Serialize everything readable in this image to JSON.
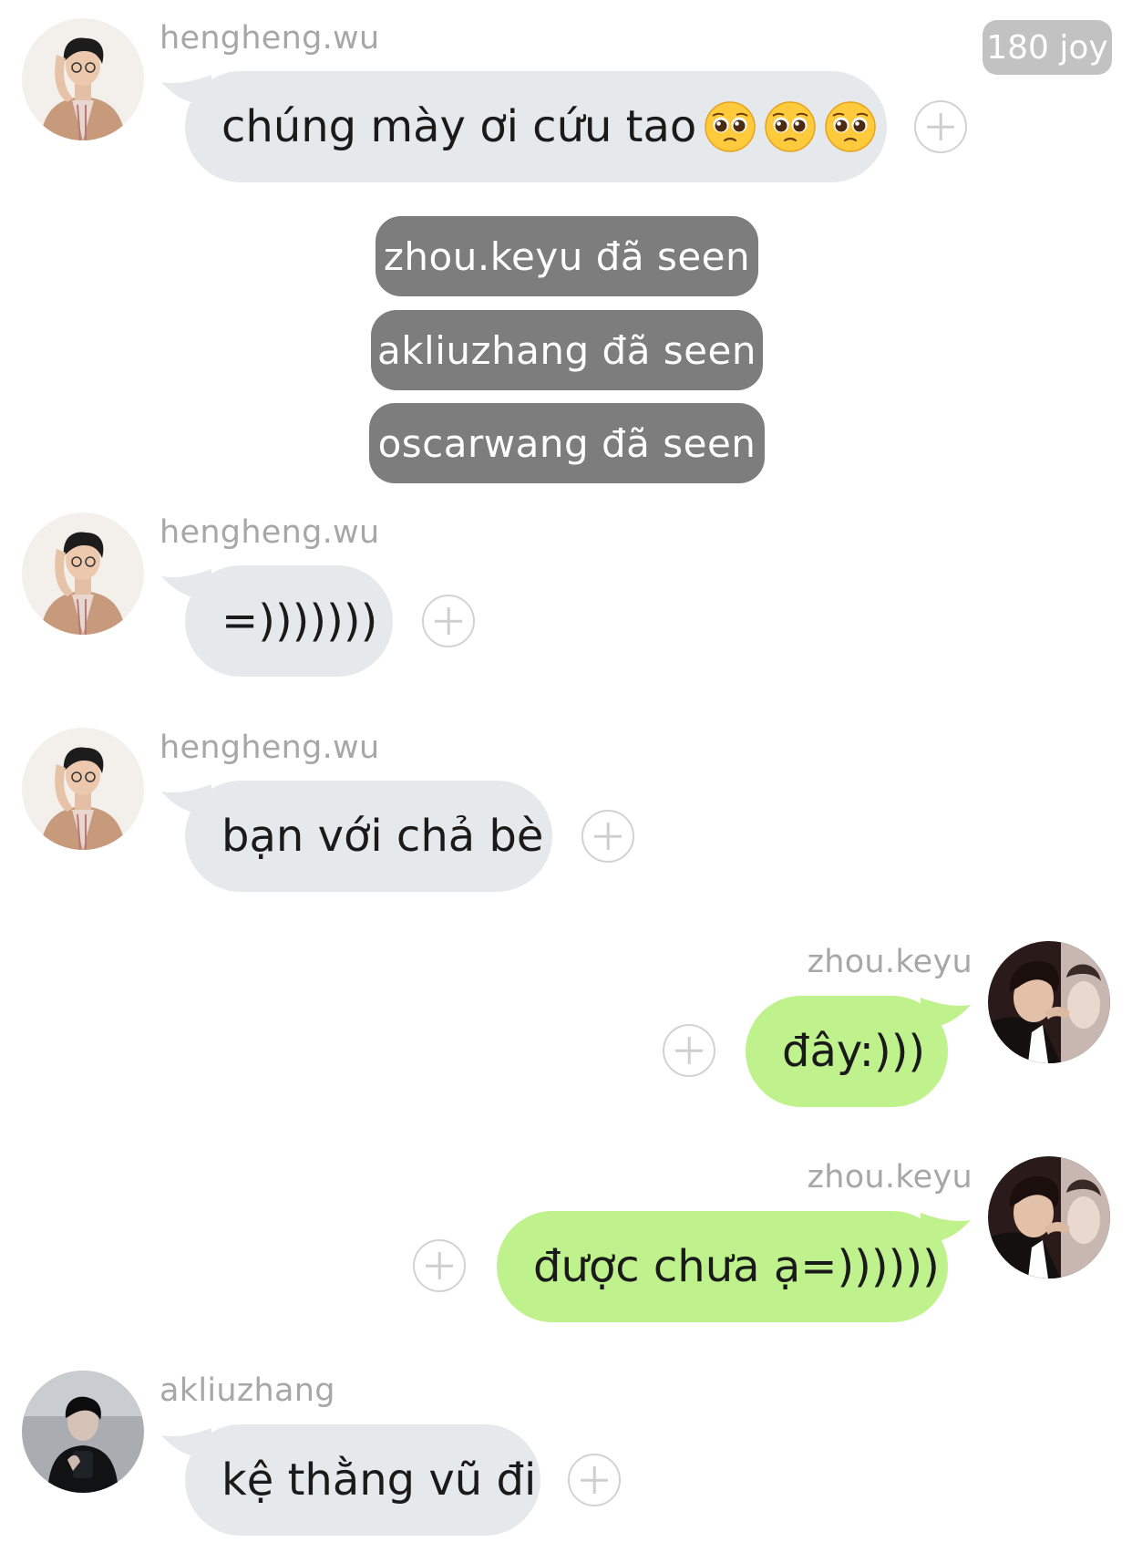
{
  "header": {
    "badge": "180 joy"
  },
  "colors": {
    "incoming_bubble": "#e6e9ec",
    "outgoing_bubble": "#bff28c",
    "seen_chip": "#7d7d7d",
    "sender_text": "#a7a7a7"
  },
  "messages": [
    {
      "sender": "hengheng.wu",
      "text": "chúng mày ơi cứu tao",
      "emoji": [
        "pleading-face-emoji",
        "pleading-face-emoji",
        "pleading-face-emoji"
      ]
    },
    {
      "sender": "hengheng.wu",
      "text": "=)))))))"
    },
    {
      "sender": "hengheng.wu",
      "text": "bạn với chả bè"
    },
    {
      "sender": "zhou.keyu",
      "text": "đây:)))"
    },
    {
      "sender": "zhou.keyu",
      "text": "được chưa ạ=))))))"
    },
    {
      "sender": "akliuzhang",
      "text": "kệ thằng vũ đi"
    }
  ],
  "seen": [
    {
      "text": "zhou.keyu đã seen"
    },
    {
      "text": "akliuzhang đã seen"
    },
    {
      "text": "oscarwang đã seen"
    }
  ],
  "icons": {
    "add": "plus-circle-icon",
    "emoji": "pleading-face-emoji"
  }
}
